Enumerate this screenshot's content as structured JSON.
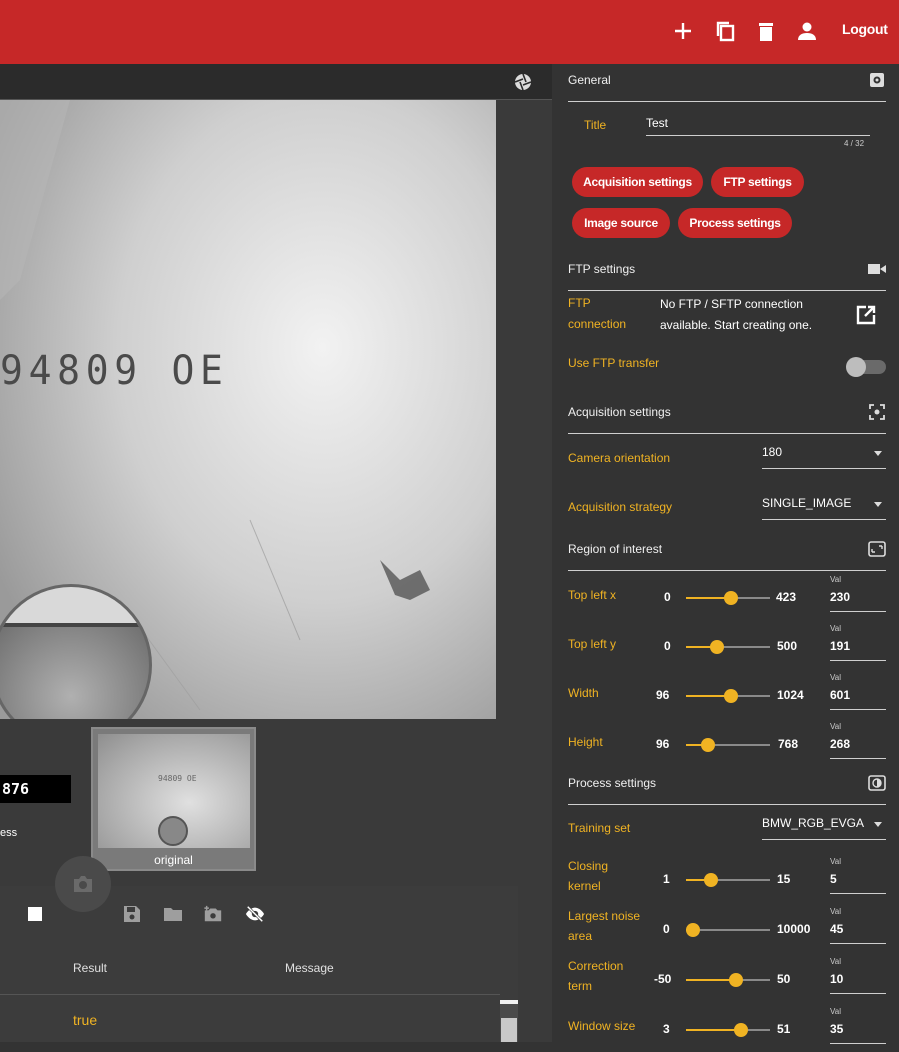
{
  "topbar": {
    "icons": [
      "add-icon",
      "copy-icon",
      "delete-icon",
      "user-icon"
    ],
    "logout_label": "Logout",
    "color": "#c62828"
  },
  "image_view": {
    "image_text": "94809 OE",
    "ocr_result": "876",
    "status_text": "ess",
    "thumbnail_label": "original",
    "thumbnail_text": "94809 OE"
  },
  "table": {
    "columns": [
      "Result",
      "Message"
    ],
    "rows": [
      {
        "result": "true",
        "message": ""
      }
    ]
  },
  "general": {
    "title": "General",
    "title_label": "Title",
    "title_value": "Test",
    "title_counter": "4 / 32",
    "chips": [
      "Acquisition settings",
      "FTP settings",
      "Image source",
      "Process settings"
    ]
  },
  "ftp": {
    "title": "FTP settings",
    "connection_label_1": "FTP",
    "connection_label_2": "connection",
    "connection_text_1": "No FTP / SFTP connection",
    "connection_text_2": "available. Start creating one.",
    "use_ftp_label": "Use FTP transfer",
    "use_ftp_enabled": false
  },
  "acquisition": {
    "title": "Acquisition settings",
    "camera_orientation_label": "Camera orientation",
    "camera_orientation_value": "180",
    "strategy_label": "Acquisition strategy",
    "strategy_value": "SINGLE_IMAGE"
  },
  "roi": {
    "title": "Region of interest",
    "val_caption": "Val",
    "sliders": [
      {
        "label": "Top left x",
        "min": "0",
        "max": "423",
        "value": "230"
      },
      {
        "label": "Top left y",
        "min": "0",
        "max": "500",
        "value": "191"
      },
      {
        "label": "Width",
        "min": "96",
        "max": "1024",
        "value": "601"
      },
      {
        "label": "Height",
        "min": "96",
        "max": "768",
        "value": "268"
      }
    ]
  },
  "process": {
    "title": "Process settings",
    "training_set_label": "Training set",
    "training_set_value": "BMW_RGB_EVGA",
    "val_caption": "Val",
    "sliders": [
      {
        "label_1": "Closing",
        "label_2": "kernel",
        "min": "1",
        "max": "15",
        "value": "5"
      },
      {
        "label_1": "Largest noise",
        "label_2": "area",
        "min": "0",
        "max": "10000",
        "value": "45"
      },
      {
        "label_1": "Correction",
        "label_2": "term",
        "min": "-50",
        "max": "50",
        "value": "10"
      },
      {
        "label_1": "Window size",
        "label_2": "",
        "min": "3",
        "max": "51",
        "value": "35"
      }
    ]
  },
  "colors": {
    "accent": "#f0b323",
    "brand": "#c62828",
    "panel": "#333333"
  }
}
